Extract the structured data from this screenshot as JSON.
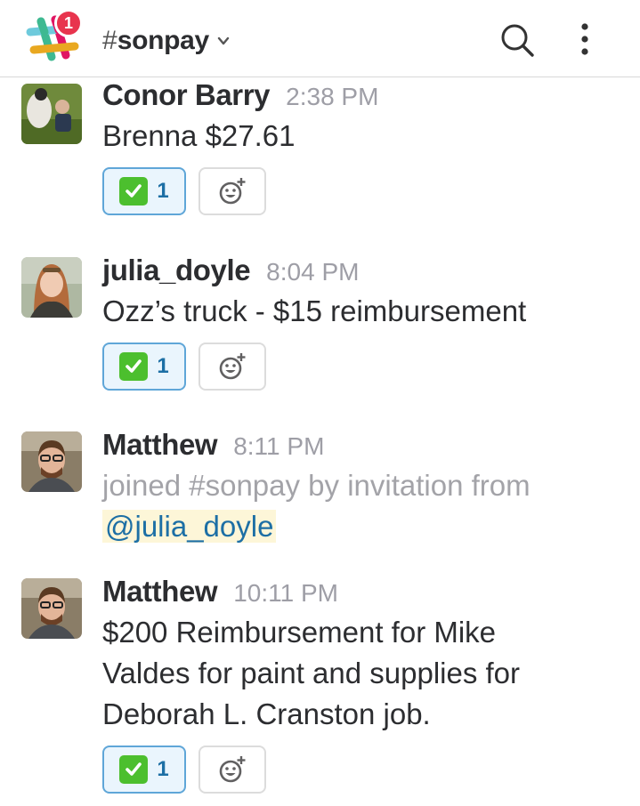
{
  "header": {
    "notification_count": "1",
    "channel_hash": "#",
    "channel_name": "sonpay",
    "icons": {
      "logo": "slack-logo",
      "search": "search-icon",
      "more": "kebab-menu-icon",
      "dropdown": "chevron-down-icon"
    },
    "badge_color": "#e8344e"
  },
  "messages": [
    {
      "author": "Conor Barry",
      "time": "2:38 PM",
      "text": "Brenna $27.61",
      "reaction": {
        "emoji": "white-check-mark",
        "count": "1"
      }
    },
    {
      "author": "julia_doyle",
      "time": "8:04 PM",
      "text": "Ozz’s truck - $15 reimbursement",
      "reaction": {
        "emoji": "white-check-mark",
        "count": "1"
      }
    },
    {
      "author": "Matthew",
      "time": "8:11 PM",
      "system_text": "joined #sonpay by invitation from",
      "mention": "@julia_doyle"
    },
    {
      "author": "Matthew",
      "time": "10:11 PM",
      "text_lines": [
        "$200 Reimbursement for Mike",
        "Valdes for paint and supplies for",
        "Deborah L. Cranston job."
      ],
      "reaction": {
        "emoji": "white-check-mark",
        "count": "1"
      }
    }
  ],
  "colors": {
    "text": "#2c2d30",
    "timestamp": "#9e9ea6",
    "mention": "#1d6fa5",
    "reaction_border": "#5fa6d8",
    "reaction_bg": "#eaf5fd",
    "check_green": "#4cbf2e"
  }
}
